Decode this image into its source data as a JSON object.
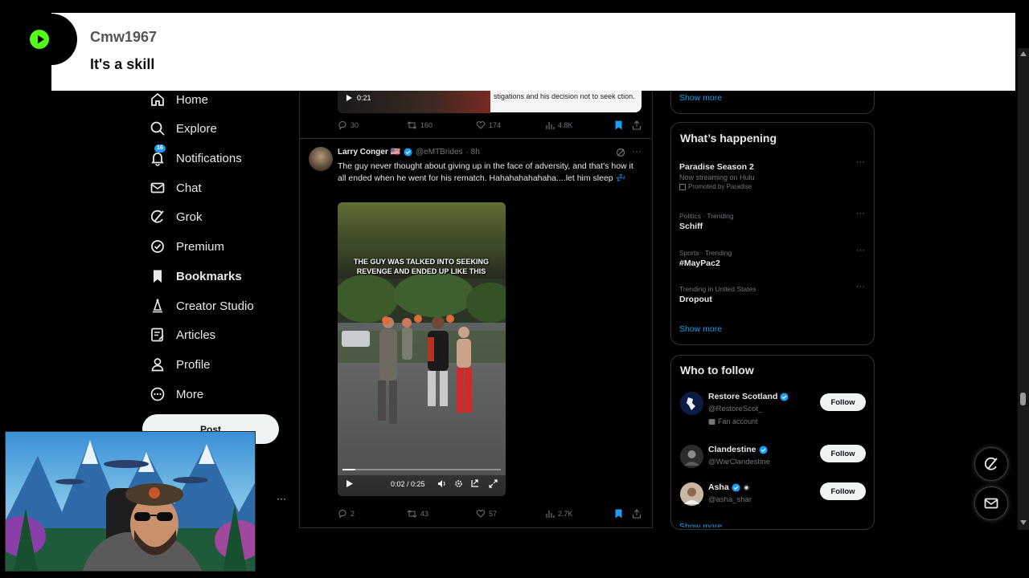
{
  "overlay": {
    "username": "Cmw1967",
    "message": "It's a skill"
  },
  "nav": {
    "items": [
      {
        "label": "Home",
        "icon": "home-icon"
      },
      {
        "label": "Explore",
        "icon": "search-icon"
      },
      {
        "label": "Notifications",
        "icon": "bell-icon",
        "badge": "16"
      },
      {
        "label": "Chat",
        "icon": "envelope-icon"
      },
      {
        "label": "Grok",
        "icon": "grok-icon"
      },
      {
        "label": "Premium",
        "icon": "verified-badge-icon"
      },
      {
        "label": "Bookmarks",
        "icon": "bookmark-icon"
      },
      {
        "label": "Creator Studio",
        "icon": "creator-studio-icon"
      },
      {
        "label": "Articles",
        "icon": "articles-icon"
      },
      {
        "label": "Profile",
        "icon": "person-icon"
      },
      {
        "label": "More",
        "icon": "more-circle-icon"
      }
    ],
    "post_label": "Post"
  },
  "feed": {
    "prev_post": {
      "video_time": "0:21",
      "card_text": "stigations and his decision not to seek ction.",
      "actions": {
        "replies": "30",
        "reposts": "160",
        "likes": "174",
        "views": "4.8K"
      }
    },
    "post": {
      "author": "Larry Conger 🇺🇸",
      "handle": "@eMTBrides",
      "time": "· 8h",
      "text": "The guy never thought about giving up in the face of adversity, and that's how it all ended when he went for his rematch. Hahahahahahaha....let him sleep 💤",
      "video_caption": "THE GUY WAS TALKED INTO SEEKING REVENGE AND ENDED UP LIKE THIS",
      "video_time": "0:02 / 0:25",
      "video_progress": 0.08,
      "actions": {
        "replies": "2",
        "reposts": "43",
        "likes": "57",
        "views": "2.7K"
      }
    }
  },
  "sidebar": {
    "top_show_more": "Show more",
    "happening_title": "What’s happening",
    "trends": [
      {
        "meta": "",
        "title": "Paradise Season 2",
        "sub": "Now streaming on Hulu",
        "sub2": "Promoted by Paradise"
      },
      {
        "meta": "Politics · Trending",
        "title": "Schiff",
        "sub": "",
        "sub2": ""
      },
      {
        "meta": "Sports · Trending",
        "title": "#MayPac2",
        "sub": "",
        "sub2": ""
      },
      {
        "meta": "Trending in United States",
        "title": "Dropout",
        "sub": "",
        "sub2": ""
      }
    ],
    "happening_show_more": "Show more",
    "follow_title": "Who to follow",
    "follow": [
      {
        "name": "Restore Scotland",
        "handle": "@RestoreScot_",
        "extra": "Fan account",
        "button": "Follow"
      },
      {
        "name": "Clandestine",
        "handle": "@WarClandestine",
        "extra": "",
        "button": "Follow"
      },
      {
        "name": "Asha",
        "handle": "@asha_shar",
        "extra": "",
        "button": "Follow"
      }
    ],
    "follow_show_more": "Show more"
  },
  "colors": {
    "accent": "#1d9bf0",
    "kick_green": "#53fc18",
    "background": "#000000"
  }
}
